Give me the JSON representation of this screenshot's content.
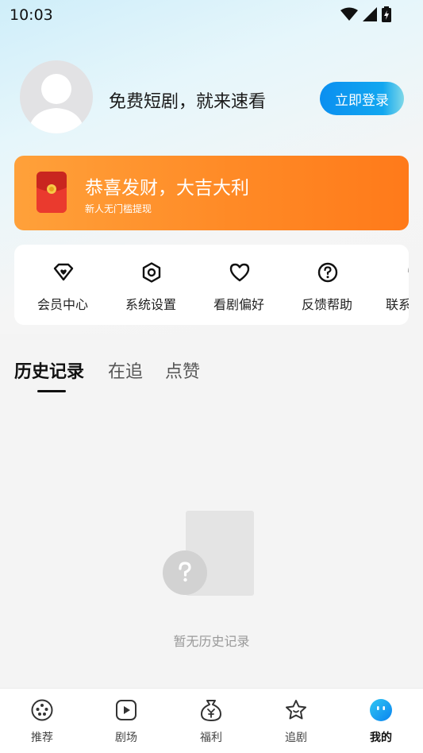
{
  "status_bar": {
    "time": "10:03"
  },
  "profile": {
    "slogan": "免费短剧，就来速看",
    "login_label": "立即登录"
  },
  "promo": {
    "title": "恭喜发财，大吉大利",
    "subtitle": "新人无门槛提现"
  },
  "quick_actions": [
    {
      "label": "会员中心",
      "icon": "vip-heart-icon"
    },
    {
      "label": "系统设置",
      "icon": "hex-settings-icon"
    },
    {
      "label": "看剧偏好",
      "icon": "heart-icon"
    },
    {
      "label": "反馈帮助",
      "icon": "help-circle-icon"
    },
    {
      "label": "联系",
      "icon": "contact-icon"
    }
  ],
  "tabs": [
    {
      "label": "历史记录",
      "active": true
    },
    {
      "label": "在追",
      "active": false
    },
    {
      "label": "点赞",
      "active": false
    }
  ],
  "empty_state": {
    "text": "暂无历史记录"
  },
  "bottom_nav": [
    {
      "label": "推荐",
      "icon": "film-reel-icon",
      "active": false
    },
    {
      "label": "剧场",
      "icon": "play-square-icon",
      "active": false
    },
    {
      "label": "福利",
      "icon": "money-bag-icon",
      "active": false
    },
    {
      "label": "追剧",
      "icon": "star-icon",
      "active": false
    },
    {
      "label": "我的",
      "icon": "profile-face-icon",
      "active": true
    }
  ],
  "colors": {
    "accent_blue": "#0b8ff0",
    "promo_orange": "#ff8a26",
    "redpack_red": "#e8322b"
  }
}
